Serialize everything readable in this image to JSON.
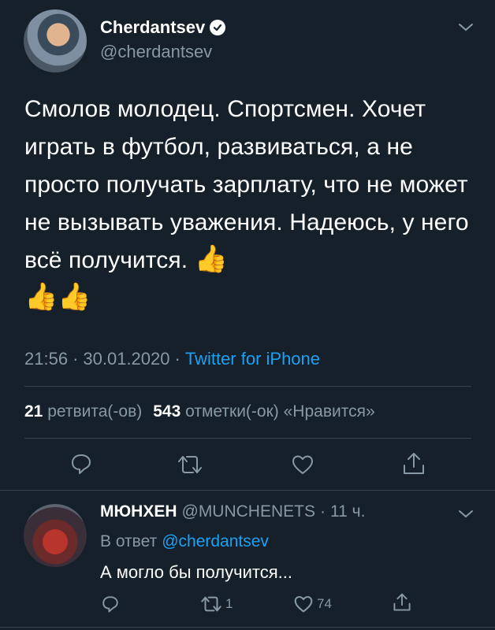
{
  "author": {
    "display_name": "Cherdantsev",
    "handle": "@cherdantsev"
  },
  "tweet": {
    "text": "Смолов молодец. Спортсмен. Хочет играть в футбол, развиваться, а не просто получать зарплату, что не может не вызывать уважения. Надеюсь, у него всё получится.",
    "emoji_end": "👍",
    "emoji_line2": "👍👍",
    "time": "21:56",
    "date": "30.01.2020",
    "source": "Twitter for iPhone"
  },
  "stats": {
    "retweets_count": "21",
    "retweets_label": "ретвита(-ов)",
    "likes_count": "543",
    "likes_label": "отметки(-ок) «Нравится»"
  },
  "reply": {
    "display_name": "МЮНХЕН",
    "handle": "@MUNCHENETS",
    "time_ago": "11 ч.",
    "in_reply_prefix": "В ответ",
    "in_reply_handle": "@cherdantsev",
    "text": "А могло бы получится...",
    "retweets": "1",
    "likes": "74"
  },
  "separator": "·",
  "colors": {
    "background": "#15202b",
    "text": "#ffffff",
    "muted": "#8899a6",
    "accent": "#1da1f2",
    "divider": "#38444d"
  },
  "icons": [
    "verified-icon",
    "chevron-down-icon",
    "reply-icon",
    "retweet-icon",
    "like-icon",
    "share-icon"
  ]
}
